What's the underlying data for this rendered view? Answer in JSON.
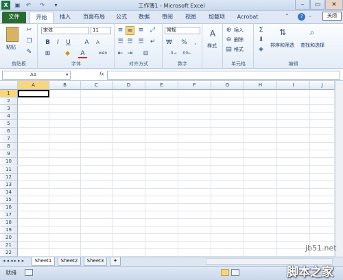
{
  "window": {
    "title": "工作簿1 - Microsoft Excel",
    "close_tooltip": "关闭"
  },
  "tabs": [
    "文件",
    "开始",
    "插入",
    "页面布局",
    "公式",
    "数据",
    "审阅",
    "视图",
    "加载项",
    "Acrobat"
  ],
  "ribbon": {
    "clipboard": {
      "paste": "粘贴",
      "group": "剪贴板"
    },
    "font": {
      "name": "宋体",
      "size": "11",
      "bold": "B",
      "italic": "I",
      "underline": "U",
      "grow": "A",
      "shrink": "A",
      "font_color": "A",
      "phonetic": "wén",
      "group": "字体"
    },
    "alignment": {
      "group": "对齐方式"
    },
    "number": {
      "format": "常规",
      "percent": "%",
      "comma": ",",
      "group": "数字"
    },
    "styles": {
      "label": "样式",
      "group": "样式"
    },
    "cells": {
      "insert": "插入",
      "delete": "删除",
      "format": "格式",
      "group": "单元格"
    },
    "editing": {
      "sort": "排序和筛选",
      "find": "查找和选择",
      "group": "编辑"
    }
  },
  "formula_bar": {
    "cell_ref": "A1",
    "fx": "fx"
  },
  "columns": [
    "A",
    "B",
    "C",
    "D",
    "E",
    "F",
    "G",
    "H",
    "I",
    "J"
  ],
  "rows": [
    "1",
    "2",
    "3",
    "4",
    "5",
    "6",
    "7",
    "8",
    "9",
    "10",
    "11",
    "12",
    "13",
    "14",
    "15",
    "16",
    "17",
    "18",
    "19",
    "20",
    "21",
    "22"
  ],
  "sheets": [
    "Sheet1",
    "Sheet2",
    "Sheet3"
  ],
  "status": {
    "ready": "就绪"
  },
  "watermark": {
    "site": "jb51.net",
    "brand": "脚本之家"
  },
  "colors": {
    "file_tab": "#2a6b2f",
    "accent": "#2b4f86",
    "selected_header": "#f9d57c"
  }
}
